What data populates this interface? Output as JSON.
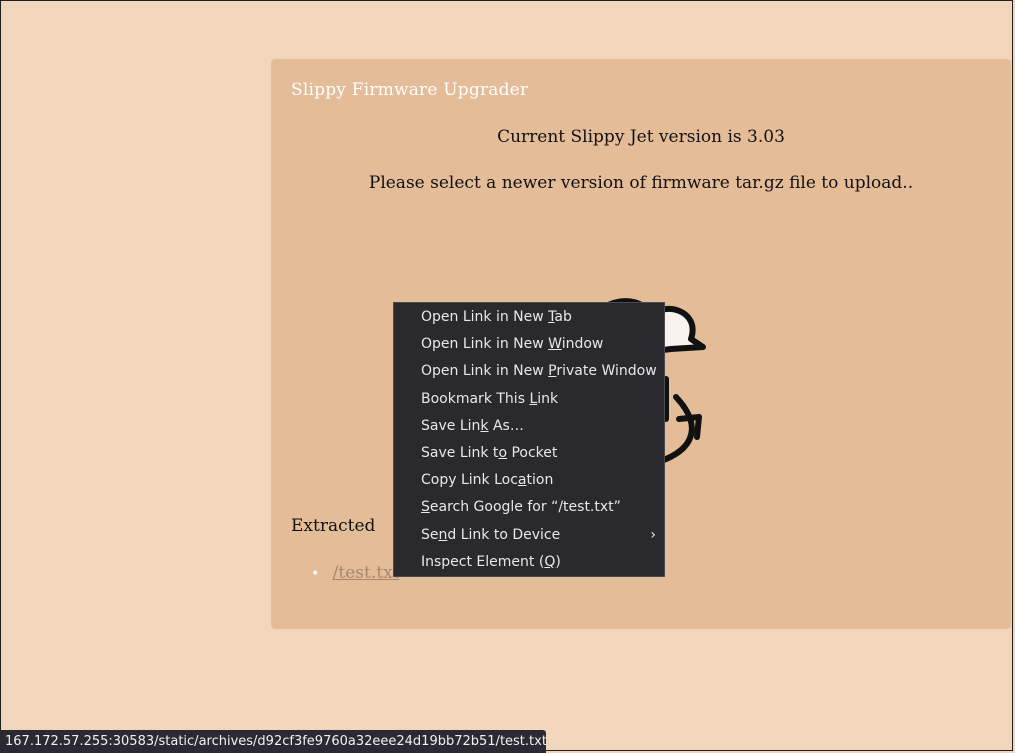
{
  "page": {
    "app_title": "Slippy Firmware Upgrader",
    "version_text": "Current Slippy Jet version is 3.03",
    "instruction_text": "Please select a newer version of firmware tar.gz file to upload..",
    "extracted_heading": "Extracted",
    "files": [
      "/test.txt"
    ]
  },
  "context_menu": {
    "items": [
      {
        "pre": "Open Link in New ",
        "ul": "T",
        "post": "ab",
        "submenu": false
      },
      {
        "pre": "Open Link in New ",
        "ul": "W",
        "post": "indow",
        "submenu": false
      },
      {
        "pre": "Open Link in New ",
        "ul": "P",
        "post": "rivate Window",
        "submenu": false
      },
      {
        "pre": "Bookmark This ",
        "ul": "L",
        "post": "ink",
        "submenu": false
      },
      {
        "pre": "Save Lin",
        "ul": "k",
        "post": " As…",
        "submenu": false
      },
      {
        "pre": "Save Link t",
        "ul": "o",
        "post": " Pocket",
        "submenu": false
      },
      {
        "pre": "Copy Link Loc",
        "ul": "a",
        "post": "tion",
        "submenu": false
      },
      {
        "pre": "",
        "ul": "S",
        "post": "earch Google for “/test.txt”",
        "submenu": false
      },
      {
        "pre": "Se",
        "ul": "n",
        "post": "d Link to Device",
        "submenu": true
      },
      {
        "pre": "Inspect Element (",
        "ul": "Q",
        "post": ")",
        "submenu": false
      }
    ]
  },
  "status_bar": {
    "url": "167.172.57.255:30583/static/archives/d92cf3fe9760a32eee24d19bb72b51/test.txt"
  },
  "colors": {
    "page_bg": "#f2d6bb",
    "panel_bg": "#e4bc98",
    "menu_bg": "#2a2a2e",
    "link": "#a7876c"
  },
  "icons": {
    "submenu": "chevron-right-icon",
    "upload": "cloud-upload-icon"
  }
}
